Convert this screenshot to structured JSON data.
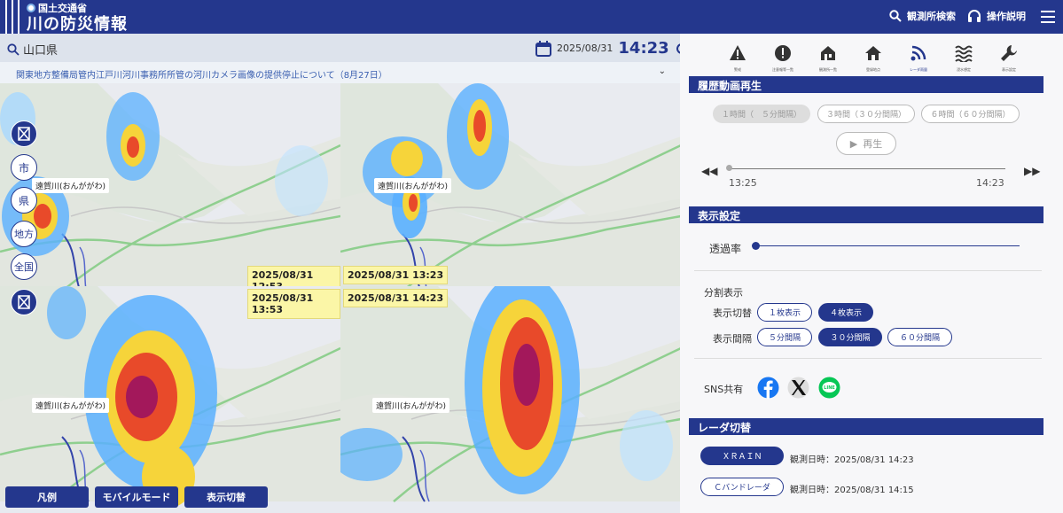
{
  "header": {
    "ministry": "国土交通省",
    "title": "川の防災情報",
    "search_label": "観測所検索",
    "help_label": "操作説明"
  },
  "map_bar": {
    "prefecture": "山口県",
    "date": "2025/08/31",
    "time": "14:23"
  },
  "notice": "関東地方整備局管内江戸川河川事務所所管の河川カメラ画像の提供停止について（8月27日）",
  "panels": [
    {
      "timestamp": "2025/08/31 12:53",
      "river_label": "遠賀川(おんががわ)"
    },
    {
      "timestamp": "2025/08/31 13:23",
      "river_label": "遠賀川(おんががわ)"
    },
    {
      "timestamp": "2025/08/31 13:53",
      "river_label": "遠賀川(おんががわ)"
    },
    {
      "timestamp": "2025/08/31 14:23",
      "river_label": "遠賀川(おんががわ)"
    }
  ],
  "side_buttons": {
    "city": "市",
    "pref": "県",
    "region": "地方",
    "all": "全国"
  },
  "bottom_buttons": {
    "legend": "凡例",
    "mobile": "モバイルモード",
    "display": "表示切替"
  },
  "toolbar": [
    {
      "icon": "warning-icon",
      "label": "警戒"
    },
    {
      "icon": "alert-icon",
      "label": "注意報等一覧"
    },
    {
      "icon": "station-icon",
      "label": "観測所一覧"
    },
    {
      "icon": "home-icon",
      "label": "登録地点"
    },
    {
      "icon": "radar-icon",
      "label": "レーダ雨量"
    },
    {
      "icon": "wave-icon",
      "label": "浸水想定"
    },
    {
      "icon": "wrench-icon",
      "label": "表示設定"
    }
  ],
  "history": {
    "heading": "履歴動画再生",
    "opt1": "１時間（　５分間隔）",
    "opt2": "３時間（３０分間隔）",
    "opt3": "６時間（６０分間隔）",
    "play": "再生",
    "start_time": "13:25",
    "end_time": "14:23"
  },
  "display_settings": {
    "heading": "表示設定",
    "opacity_label": "透過率",
    "split_label": "分割表示",
    "switch_label": "表示切替",
    "one": "１枚表示",
    "four": "４枚表示",
    "interval_label": "表示間隔",
    "i5": "５分間隔",
    "i30": "３０分間隔",
    "i60": "６０分間隔",
    "sns_label": "SNS共有"
  },
  "radar": {
    "heading": "レーダ切替",
    "xrain": "ＸＲＡＩＮ",
    "xrain_time": "観測日時：2025/08/31 14:23",
    "cband": "Ｃバンドレーダ",
    "cband_time": "観測日時：2025/08/31 14:15"
  },
  "colors": {
    "brand": "#24378d",
    "notice": "#3a5fb0"
  }
}
